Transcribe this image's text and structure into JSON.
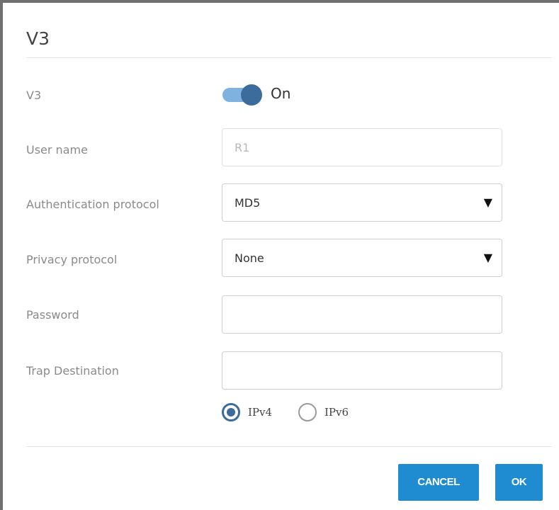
{
  "dialog": {
    "title": "V3"
  },
  "form": {
    "v3": {
      "label": "V3",
      "toggle_state": "On",
      "enabled": true
    },
    "user_name": {
      "label": "User name",
      "value": "R1"
    },
    "auth_protocol": {
      "label": "Authentication protocol",
      "selected": "MD5"
    },
    "privacy_protocol": {
      "label": "Privacy protocol",
      "selected": "None"
    },
    "password": {
      "label": "Password",
      "value": ""
    },
    "trap_destination": {
      "label": "Trap Destination",
      "value": "",
      "ip_options": [
        {
          "label": "IPv4",
          "checked": true
        },
        {
          "label": "IPv6",
          "checked": false
        }
      ]
    }
  },
  "footer": {
    "cancel_label": "CANCEL",
    "ok_label": "OK"
  },
  "icons": {
    "caret": "caret-down-icon"
  },
  "colors": {
    "accent": "#1f8bd0",
    "toggle_knob": "#3c6c9c",
    "toggle_track": "#7fb2de"
  }
}
